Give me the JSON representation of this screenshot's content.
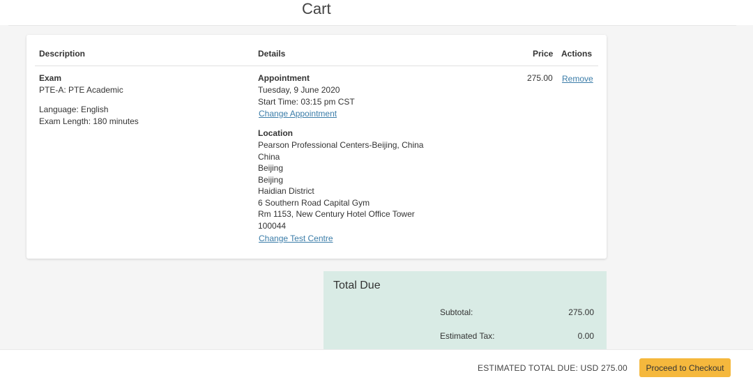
{
  "header": {
    "title": "Cart"
  },
  "table": {
    "columns": {
      "description": "Description",
      "details": "Details",
      "price": "Price",
      "actions": "Actions"
    },
    "item": {
      "exam_label": "Exam",
      "exam_name": "PTE-A: PTE Academic",
      "language": "Language: English",
      "exam_length": "Exam Length: 180 minutes",
      "appointment_label": "Appointment",
      "appointment_date": "Tuesday, 9 June 2020",
      "start_time": "Start Time: 03:15 pm CST",
      "change_appointment": "Change Appointment",
      "location_label": "Location",
      "location_lines": [
        "Pearson Professional Centers-Beijing, China",
        "China",
        "Beijing",
        "Beijing",
        "Haidian District",
        "6 Southern Road Capital Gym",
        "Rm 1153, New Century Hotel Office Tower",
        "100044"
      ],
      "change_test_centre": "Change Test Centre",
      "price": "275.00",
      "remove": "Remove"
    }
  },
  "total_due": {
    "title": "Total Due",
    "subtotal_label": "Subtotal:",
    "subtotal_value": "275.00",
    "tax_label": "Estimated Tax:",
    "tax_value": "0.00"
  },
  "footer": {
    "estimated_total": "ESTIMATED TOTAL DUE: USD 275.00",
    "checkout_button": "Proceed to Checkout"
  },
  "colors": {
    "accent_button": "#f5b83d",
    "total_box_bg": "#d9ebe5",
    "link": "#3a7ca8"
  }
}
